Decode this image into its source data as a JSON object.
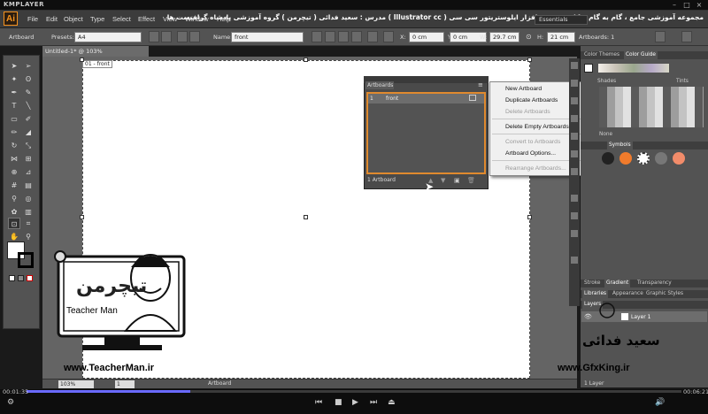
{
  "player": {
    "logo": "KMPLAYER",
    "time_current": "00:01:35",
    "time_total": "00:06:21",
    "progress": 0.25
  },
  "menubar": {
    "app_logo": "Ai",
    "items": [
      "File",
      "Edit",
      "Object",
      "Type",
      "Select",
      "Effect",
      "View",
      "Window",
      "Help"
    ],
    "course_title": "مجموعه آموزشی جامع ، گام به گام و کاربردی نرم افزار ایلوستریتور سی سی ( Illustrator cc )   مدرس : سعید فدائی ( تیچرمن ) گروه آموزشی پادشاه گرافیست ها",
    "workspace": "Essentials"
  },
  "controlbar": {
    "label_artboard": "Artboard",
    "presets_label": "Presets:",
    "presets_value": "A4",
    "name_label": "Name:",
    "name_value": "front",
    "x_label": "X:",
    "x_value": "0 cm",
    "y_label": "Y:",
    "y_value": "0 cm",
    "w_label": "W:",
    "w_value": "29.7 cm",
    "h_label": "H:",
    "h_value": "21 cm",
    "artboards_label": "Artboards: 1"
  },
  "document": {
    "tab_title": "Untitled-1* @ 103% (CMYK/Preview)",
    "artboard_label": "01 - front",
    "zoom": "103%",
    "page": "1",
    "status": "Artboard"
  },
  "artboards_panel": {
    "tab": "Artboards",
    "rows": [
      {
        "num": "1",
        "name": "front"
      }
    ],
    "footer": "1 Artboard"
  },
  "flyout": {
    "items": [
      {
        "label": "New Artboard",
        "disabled": false
      },
      {
        "label": "Duplicate Artboards",
        "disabled": false
      },
      {
        "label": "Delete Artboards",
        "disabled": true
      },
      {
        "label": "Delete Empty Artboards",
        "disabled": false
      },
      {
        "label": "Convert to Artboards",
        "disabled": true
      },
      {
        "label": "Artboard Options...",
        "disabled": false
      },
      {
        "label": "Rearrange Artboards...",
        "disabled": true
      }
    ]
  },
  "right_panels": {
    "color_tabs": [
      "Color Themes",
      "Color Guide"
    ],
    "shades": "Shades",
    "tints": "Tints",
    "none": "None",
    "symbols_tab": "Symbols",
    "stroke_tabs": [
      "Stroke",
      "Gradient",
      "Transparency"
    ],
    "libs_tabs": [
      "Libraries",
      "Appearance",
      "Graphic Styles"
    ],
    "layers_tab": "Layers",
    "layer_name": "Layer 1",
    "layers_footer": "1 Layer"
  },
  "watermark": {
    "url_left": "www.TeacherMan.ir",
    "url_right": "www.GfxKing.ir",
    "brand": "Teacher Man",
    "signature": "سعید فدائی"
  },
  "colors": {
    "accent_orange": "#e08a2e",
    "ai_orange": "#f7931e",
    "panel_gray": "#535353"
  }
}
